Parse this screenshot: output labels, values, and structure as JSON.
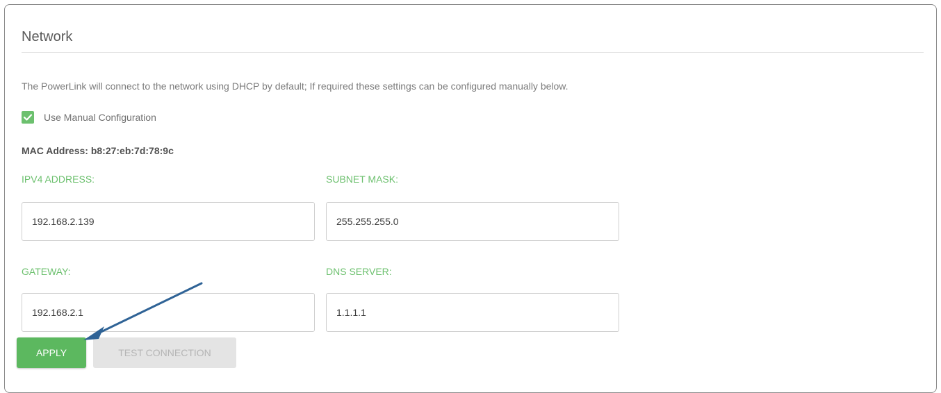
{
  "panel": {
    "title": "Network",
    "description": "The PowerLink will connect to the network using DHCP by default; If required these settings can be configured manually below."
  },
  "manual_config": {
    "label": "Use Manual Configuration",
    "checked": true
  },
  "mac": {
    "text": "MAC Address: b8:27:eb:7d:78:9c"
  },
  "fields": {
    "ipv4": {
      "label": "IPV4 ADDRESS:",
      "value": "192.168.2.139"
    },
    "subnet": {
      "label": "SUBNET MASK:",
      "value": "255.255.255.0"
    },
    "gateway": {
      "label": "GATEWAY:",
      "value": "192.168.2.1"
    },
    "dns": {
      "label": "DNS SERVER:",
      "value": "1.1.1.1"
    }
  },
  "actions": {
    "apply_label": "APPLY",
    "test_label": "TEST CONNECTION"
  },
  "colors": {
    "accent_green": "#6cc06e",
    "apply_green": "#5cb85f",
    "annotation_arrow": "#2f6396"
  }
}
